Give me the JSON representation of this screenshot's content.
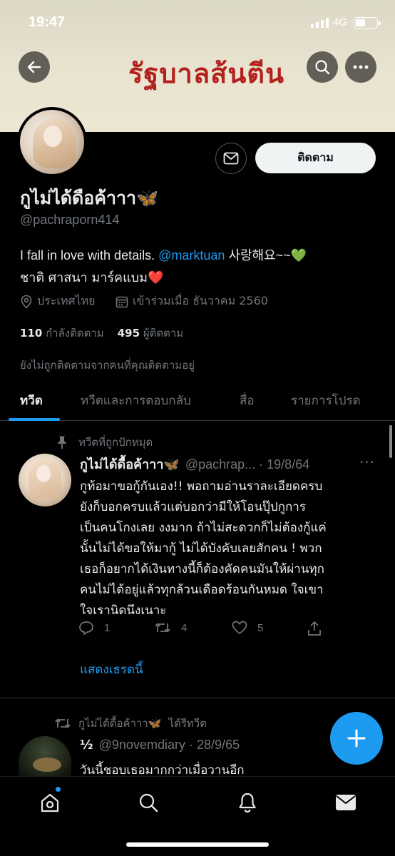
{
  "status_bar": {
    "time": "19:47",
    "network": "4G"
  },
  "header": {
    "banner_title": "รัฐบาลส้นตีน"
  },
  "profile": {
    "name": "กูไม่ได้ดือค้าาา",
    "name_emoji": "🦋",
    "handle": "@pachraporn414",
    "bio_line1_text": "I fall in love with details.",
    "bio_line1_mention": "@marktuan",
    "bio_line1_after": "사랑해요~~",
    "bio_line1_emoji": "💚",
    "bio_line2_text": "ชาติ ศาสนา มาร์คแบม",
    "bio_line2_emoji": "❤️",
    "location": "ประเทศไทย",
    "joined": "เข้าร่วมเมื่อ ธันวาคม 2560",
    "following_count": "110",
    "following_label": "กำลังติดตาม",
    "followers_count": "495",
    "followers_label": "ผู้ติดตาม",
    "not_followed_note": "ยังไม่ถูกติดตามจากคนที่คุณติดตามอยู่",
    "follow_button": "ติดตาม"
  },
  "tabs": [
    {
      "label": "ทวีต",
      "active": true
    },
    {
      "label": "ทวีตและการตอบกลับ",
      "active": false
    },
    {
      "label": "สื่อ",
      "active": false
    },
    {
      "label": "รายการโปรด",
      "active": false
    }
  ],
  "pinned_tweet": {
    "pinned_label": "ทวีตที่ถูกปักหมุด",
    "author_name": "กูไม่ได้ดื้อค้าาา",
    "author_emoji": "🦋",
    "handle_date": "@pachrap... · 19/8/64",
    "body_lines": [
      "กูท้อมาขอกู้กันเอง!! พอถามอ่านราละเอียดครบ",
      "ยังก็บอกครบแล้วแต่บอกว่ามีให้โอนปุ๊ปกูการ",
      "เป็นคนโกงเลย งงมาก ถ้าไม่สะดวกก็ไม่ต้องกู้แค่",
      "นั้นไม่ได้ขอให้มากู้ ไม่ได้บังคับเลยสักคน ! พวก",
      "เธอก็อยากได้เงินทางนี้ก็ต้องคัดคนมันให้ผ่านทุก",
      "คนไม่ได้อยู่แล้วทุกล้วนเดือดร้อนกันหมด ใจเขา",
      "ใจเรานิดนึงเนาะ"
    ],
    "replies": "1",
    "retweets": "4",
    "likes": "5",
    "show_thread": "แสดงเธรดนี้"
  },
  "retweeted_tweet": {
    "retweeter": "กูไม่ได้ดื้อค้าาา",
    "retweeter_emoji": "🦋",
    "retweet_label": "ได้รีทวีต",
    "author_name": "½",
    "handle_date": "@9novemdiary · 28/9/65",
    "body": "วันนี้ชอบเธอมากกว่าเมื่อวานอีก"
  },
  "colors": {
    "accent": "#1d9bf0",
    "banner_title": "#b3211d",
    "muted": "#71767b"
  }
}
